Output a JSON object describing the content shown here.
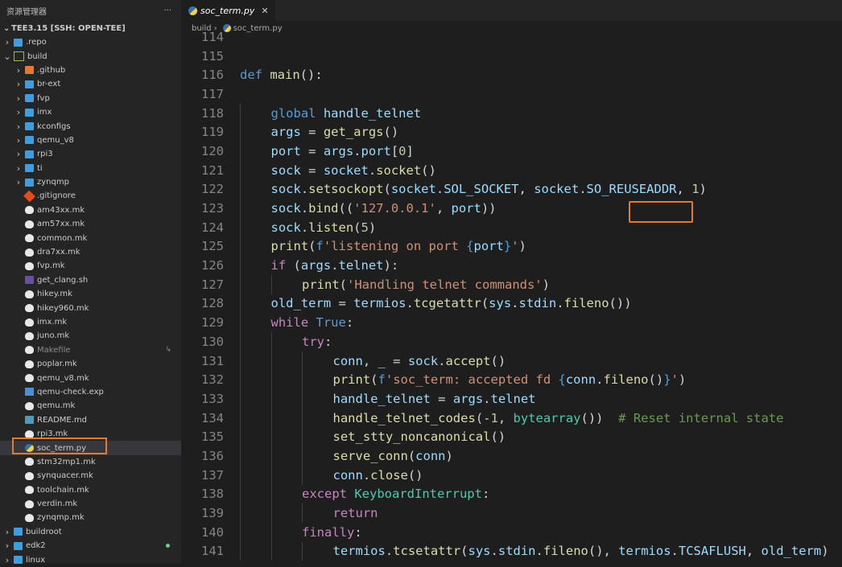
{
  "explorer": {
    "title": "资源管理器",
    "more": "···",
    "workspace": "TEE3.15 [SSH: OPEN-TEE]"
  },
  "tree": [
    {
      "name": ".repo",
      "type": "folder",
      "depth": 0,
      "chevron": "›"
    },
    {
      "name": "build",
      "type": "folder-build",
      "depth": 0,
      "chevron": "⌄"
    },
    {
      "name": ".github",
      "type": "folder-special",
      "depth": 1,
      "chevron": "›"
    },
    {
      "name": "br-ext",
      "type": "folder",
      "depth": 1,
      "chevron": "›"
    },
    {
      "name": "fvp",
      "type": "folder",
      "depth": 1,
      "chevron": "›"
    },
    {
      "name": "imx",
      "type": "folder",
      "depth": 1,
      "chevron": "›"
    },
    {
      "name": "kconfigs",
      "type": "folder",
      "depth": 1,
      "chevron": "›"
    },
    {
      "name": "qemu_v8",
      "type": "folder",
      "depth": 1,
      "chevron": "›"
    },
    {
      "name": "rpi3",
      "type": "folder",
      "depth": 1,
      "chevron": "›"
    },
    {
      "name": "ti",
      "type": "folder",
      "depth": 1,
      "chevron": "›"
    },
    {
      "name": "zynqmp",
      "type": "folder",
      "depth": 1,
      "chevron": "›"
    },
    {
      "name": ".gitignore",
      "type": "git",
      "depth": 1
    },
    {
      "name": "am43xx.mk",
      "type": "mk",
      "depth": 1
    },
    {
      "name": "am57xx.mk",
      "type": "mk",
      "depth": 1
    },
    {
      "name": "common.mk",
      "type": "mk",
      "depth": 1
    },
    {
      "name": "dra7xx.mk",
      "type": "mk",
      "depth": 1
    },
    {
      "name": "fvp.mk",
      "type": "mk",
      "depth": 1
    },
    {
      "name": "get_clang.sh",
      "type": "sh",
      "depth": 1
    },
    {
      "name": "hikey.mk",
      "type": "mk",
      "depth": 1
    },
    {
      "name": "hikey960.mk",
      "type": "mk",
      "depth": 1
    },
    {
      "name": "imx.mk",
      "type": "mk",
      "depth": 1
    },
    {
      "name": "juno.mk",
      "type": "mk",
      "depth": 1
    },
    {
      "name": "Makefile",
      "type": "mk",
      "depth": 1,
      "dim": true,
      "badge": "↳"
    },
    {
      "name": "poplar.mk",
      "type": "mk",
      "depth": 1
    },
    {
      "name": "qemu_v8.mk",
      "type": "mk",
      "depth": 1
    },
    {
      "name": "qemu-check.exp",
      "type": "exp",
      "depth": 1
    },
    {
      "name": "qemu.mk",
      "type": "mk",
      "depth": 1
    },
    {
      "name": "README.md",
      "type": "md",
      "depth": 1
    },
    {
      "name": "rpi3.mk",
      "type": "mk",
      "depth": 1
    },
    {
      "name": "soc_term.py",
      "type": "py",
      "depth": 1,
      "selected": true
    },
    {
      "name": "stm32mp1.mk",
      "type": "mk",
      "depth": 1
    },
    {
      "name": "synquacer.mk",
      "type": "mk",
      "depth": 1
    },
    {
      "name": "toolchain.mk",
      "type": "mk",
      "depth": 1
    },
    {
      "name": "verdin.mk",
      "type": "mk",
      "depth": 1
    },
    {
      "name": "zynqmp.mk",
      "type": "mk",
      "depth": 1
    },
    {
      "name": "buildroot",
      "type": "folder",
      "depth": 0,
      "chevron": "›"
    },
    {
      "name": "edk2",
      "type": "folder",
      "depth": 0,
      "chevron": "›",
      "modified": true
    },
    {
      "name": "linux",
      "type": "folder",
      "depth": 0,
      "chevron": "›"
    }
  ],
  "tab": {
    "label": "soc_term.py",
    "close": "✕"
  },
  "breadcrumb": {
    "folder": "build",
    "sep": "›",
    "file": "soc_term.py"
  },
  "code": [
    {
      "n": "114",
      "indent": 0,
      "t": [
        [
          "",
          ""
        ]
      ]
    },
    {
      "n": "115",
      "indent": 0,
      "t": [
        [
          "",
          ""
        ]
      ]
    },
    {
      "n": "116",
      "indent": 0,
      "t": [
        [
          "kw",
          "def "
        ],
        [
          "fn",
          "main"
        ],
        [
          "",
          "():"
        ]
      ]
    },
    {
      "n": "117",
      "indent": 0,
      "t": [
        [
          "",
          ""
        ]
      ]
    },
    {
      "n": "118",
      "indent": 1,
      "t": [
        [
          "kw",
          "global "
        ],
        [
          "var",
          "handle_telnet"
        ]
      ]
    },
    {
      "n": "119",
      "indent": 1,
      "t": [
        [
          "var",
          "args"
        ],
        [
          "",
          " = "
        ],
        [
          "fn",
          "get_args"
        ],
        [
          "",
          "()"
        ]
      ]
    },
    {
      "n": "120",
      "indent": 1,
      "t": [
        [
          "var",
          "port"
        ],
        [
          "",
          " = "
        ],
        [
          "var",
          "args"
        ],
        [
          "",
          "."
        ],
        [
          "var",
          "port"
        ],
        [
          "",
          "["
        ],
        [
          "num",
          "0"
        ],
        [
          "",
          "]"
        ]
      ]
    },
    {
      "n": "121",
      "indent": 1,
      "t": [
        [
          "var",
          "sock"
        ],
        [
          "",
          " = "
        ],
        [
          "var",
          "socket"
        ],
        [
          "",
          "."
        ],
        [
          "fn",
          "socket"
        ],
        [
          "",
          "()"
        ]
      ]
    },
    {
      "n": "122",
      "indent": 1,
      "t": [
        [
          "var",
          "sock"
        ],
        [
          "",
          "."
        ],
        [
          "fn",
          "setsockopt"
        ],
        [
          "",
          "("
        ],
        [
          "var",
          "socket"
        ],
        [
          "",
          "."
        ],
        [
          "var",
          "SOL_SOCKET"
        ],
        [
          "",
          ", "
        ],
        [
          "var",
          "socket"
        ],
        [
          "",
          "."
        ],
        [
          "var",
          "SO_REUSEADDR"
        ],
        [
          "",
          ", "
        ],
        [
          "num",
          "1"
        ],
        [
          "",
          ")"
        ]
      ]
    },
    {
      "n": "123",
      "indent": 1,
      "t": [
        [
          "var",
          "sock"
        ],
        [
          "",
          "."
        ],
        [
          "fn",
          "bind"
        ],
        [
          "",
          "(("
        ],
        [
          "str",
          "'127.0.0.1'"
        ],
        [
          "",
          ", "
        ],
        [
          "var",
          "port"
        ],
        [
          "",
          "))"
        ]
      ]
    },
    {
      "n": "124",
      "indent": 1,
      "t": [
        [
          "var",
          "sock"
        ],
        [
          "",
          "."
        ],
        [
          "fn",
          "listen"
        ],
        [
          "",
          "("
        ],
        [
          "num",
          "5"
        ],
        [
          "",
          ")"
        ]
      ]
    },
    {
      "n": "125",
      "indent": 1,
      "t": [
        [
          "fn",
          "print"
        ],
        [
          "",
          "("
        ],
        [
          "kw",
          "f"
        ],
        [
          "str",
          "'listening on port "
        ],
        [
          "kw",
          "{"
        ],
        [
          "var",
          "port"
        ],
        [
          "kw",
          "}"
        ],
        [
          "str",
          "'"
        ],
        [
          "",
          ")"
        ]
      ]
    },
    {
      "n": "126",
      "indent": 1,
      "t": [
        [
          "ctl",
          "if "
        ],
        [
          "",
          "("
        ],
        [
          "var",
          "args"
        ],
        [
          "",
          "."
        ],
        [
          "var",
          "telnet"
        ],
        [
          "",
          "):"
        ]
      ]
    },
    {
      "n": "127",
      "indent": 2,
      "t": [
        [
          "fn",
          "print"
        ],
        [
          "",
          "("
        ],
        [
          "str",
          "'Handling telnet commands'"
        ],
        [
          "",
          ")"
        ]
      ]
    },
    {
      "n": "128",
      "indent": 1,
      "t": [
        [
          "var",
          "old_term"
        ],
        [
          "",
          " = "
        ],
        [
          "var",
          "termios"
        ],
        [
          "",
          "."
        ],
        [
          "fn",
          "tcgetattr"
        ],
        [
          "",
          "("
        ],
        [
          "var",
          "sys"
        ],
        [
          "",
          "."
        ],
        [
          "var",
          "stdin"
        ],
        [
          "",
          "."
        ],
        [
          "fn",
          "fileno"
        ],
        [
          "",
          "())"
        ]
      ]
    },
    {
      "n": "129",
      "indent": 1,
      "t": [
        [
          "ctl",
          "while "
        ],
        [
          "kw",
          "True"
        ],
        [
          "",
          ":"
        ]
      ]
    },
    {
      "n": "130",
      "indent": 2,
      "t": [
        [
          "ctl",
          "try"
        ],
        [
          "",
          ":"
        ]
      ]
    },
    {
      "n": "131",
      "indent": 3,
      "t": [
        [
          "var",
          "conn"
        ],
        [
          "",
          ", "
        ],
        [
          "var",
          "_"
        ],
        [
          "",
          " = "
        ],
        [
          "var",
          "sock"
        ],
        [
          "",
          "."
        ],
        [
          "fn",
          "accept"
        ],
        [
          "",
          "()"
        ]
      ]
    },
    {
      "n": "132",
      "indent": 3,
      "t": [
        [
          "fn",
          "print"
        ],
        [
          "",
          "("
        ],
        [
          "kw",
          "f"
        ],
        [
          "str",
          "'soc_term: accepted fd "
        ],
        [
          "kw",
          "{"
        ],
        [
          "var",
          "conn"
        ],
        [
          "",
          "."
        ],
        [
          "fn",
          "fileno"
        ],
        [
          "",
          "()"
        ],
        [
          "kw",
          "}"
        ],
        [
          "str",
          "'"
        ],
        [
          "",
          ")"
        ]
      ]
    },
    {
      "n": "133",
      "indent": 3,
      "t": [
        [
          "var",
          "handle_telnet"
        ],
        [
          "",
          " = "
        ],
        [
          "var",
          "args"
        ],
        [
          "",
          "."
        ],
        [
          "var",
          "telnet"
        ]
      ]
    },
    {
      "n": "134",
      "indent": 3,
      "t": [
        [
          "fn",
          "handle_telnet_codes"
        ],
        [
          "",
          "(-"
        ],
        [
          "num",
          "1"
        ],
        [
          "",
          ", "
        ],
        [
          "cls",
          "bytearray"
        ],
        [
          "",
          "())  "
        ],
        [
          "cmt",
          "# Reset internal state"
        ]
      ]
    },
    {
      "n": "135",
      "indent": 3,
      "t": [
        [
          "fn",
          "set_stty_noncanonical"
        ],
        [
          "",
          "()"
        ]
      ]
    },
    {
      "n": "136",
      "indent": 3,
      "t": [
        [
          "fn",
          "serve_conn"
        ],
        [
          "",
          "("
        ],
        [
          "var",
          "conn"
        ],
        [
          "",
          ")"
        ]
      ]
    },
    {
      "n": "137",
      "indent": 3,
      "t": [
        [
          "var",
          "conn"
        ],
        [
          "",
          "."
        ],
        [
          "fn",
          "close"
        ],
        [
          "",
          "()"
        ]
      ]
    },
    {
      "n": "138",
      "indent": 2,
      "t": [
        [
          "ctl",
          "except "
        ],
        [
          "cls",
          "KeyboardInterrupt"
        ],
        [
          "",
          ":"
        ]
      ]
    },
    {
      "n": "139",
      "indent": 3,
      "t": [
        [
          "ctl",
          "return"
        ]
      ]
    },
    {
      "n": "140",
      "indent": 2,
      "t": [
        [
          "ctl",
          "finally"
        ],
        [
          "",
          ":"
        ]
      ]
    },
    {
      "n": "141",
      "indent": 3,
      "t": [
        [
          "var",
          "termios"
        ],
        [
          "",
          "."
        ],
        [
          "fn",
          "tcsetattr"
        ],
        [
          "",
          "("
        ],
        [
          "var",
          "sys"
        ],
        [
          "",
          "."
        ],
        [
          "var",
          "stdin"
        ],
        [
          "",
          "."
        ],
        [
          "fn",
          "fileno"
        ],
        [
          "",
          "(), "
        ],
        [
          "var",
          "termios"
        ],
        [
          "",
          "."
        ],
        [
          "var",
          "TCSAFLUSH"
        ],
        [
          "",
          ", "
        ],
        [
          "var",
          "old_term"
        ],
        [
          "",
          ")"
        ]
      ]
    }
  ]
}
